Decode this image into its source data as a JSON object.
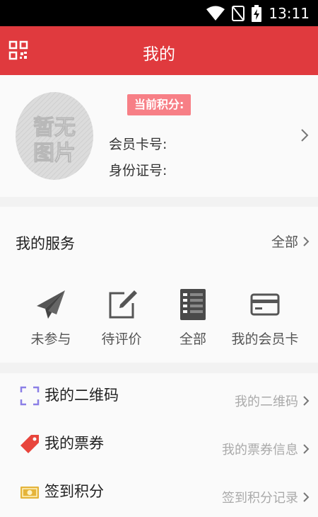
{
  "status_bar": {
    "time": "13:11"
  },
  "header": {
    "title": "我的"
  },
  "profile": {
    "avatar_text": "暂无图片",
    "points_label": "当前积分:",
    "card_label": "会员卡号:",
    "id_label": "身份证号:"
  },
  "services": {
    "title": "我的服务",
    "all_label": "全部",
    "items": [
      {
        "label": "未参与",
        "icon": "paper-plane-icon"
      },
      {
        "label": "待评价",
        "icon": "edit-icon"
      },
      {
        "label": "全部",
        "icon": "document-list-icon"
      },
      {
        "label": "我的会员卡",
        "icon": "credit-card-icon"
      }
    ]
  },
  "menu": [
    {
      "title": "我的二维码",
      "subtitle": "我的二维码",
      "icon": "qr-frame-icon"
    },
    {
      "title": "我的票券",
      "subtitle": "我的票券信息",
      "icon": "ticket-tag-icon"
    },
    {
      "title": "签到积分",
      "subtitle": "签到积分记录",
      "icon": "money-icon"
    }
  ],
  "colors": {
    "brand_red": "#e03a3e",
    "badge_pink": "#f77f86"
  }
}
